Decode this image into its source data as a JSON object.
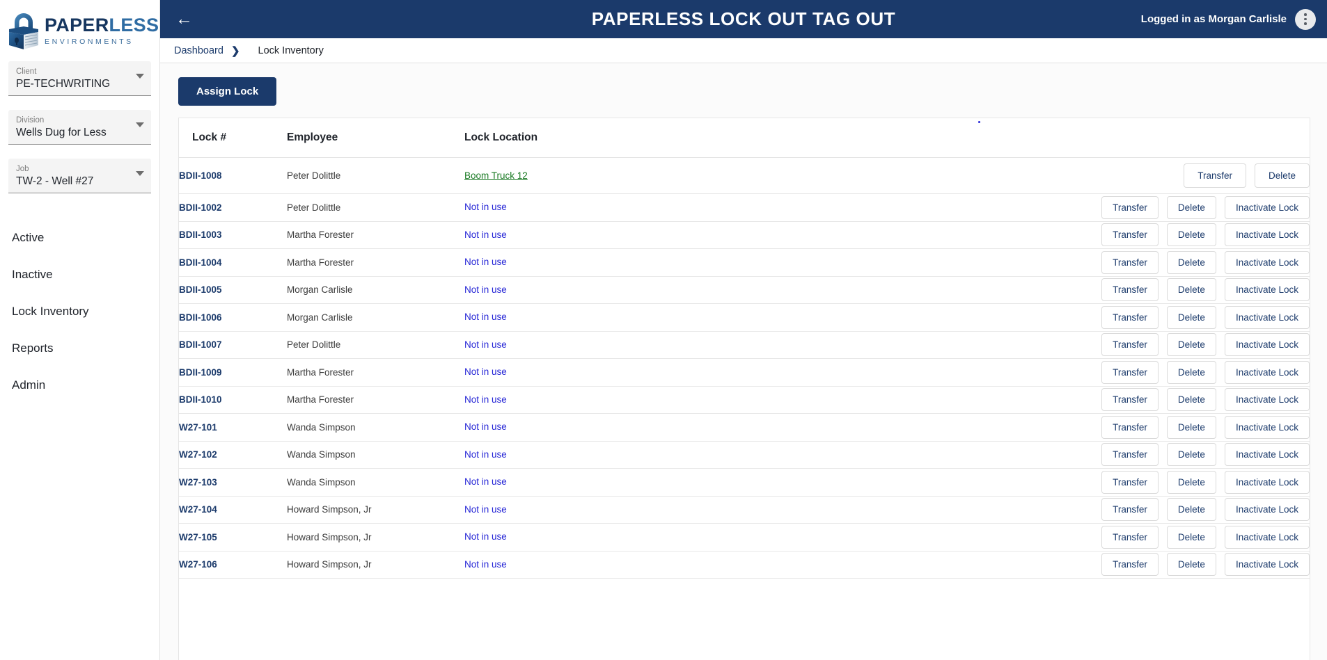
{
  "brand": {
    "title_part1": "PAPER",
    "title_part2": "LESS",
    "subtitle": "ENVIRONMENTS",
    "logo_icon": "padlock-icon",
    "navy": "#1b3a6b",
    "accent_blue": "#2f6ca3"
  },
  "header": {
    "back_icon": "back-arrow-icon",
    "title": "PAPERLESS LOCK OUT TAG OUT",
    "user_status": "Logged in as Morgan Carlisle",
    "menu_icon": "kebab-menu-icon"
  },
  "breadcrumb": {
    "parent": "Dashboard",
    "separator": "›",
    "current": "Lock Inventory"
  },
  "sidebar": {
    "selects": [
      {
        "label": "Client",
        "value": "PE-TECHWRITING",
        "icon": "chevron-down-icon"
      },
      {
        "label": "Division",
        "value": "Wells Dug for Less",
        "icon": "chevron-down-icon"
      },
      {
        "label": "Job",
        "value": "TW-2 - Well #27",
        "icon": "chevron-down-icon"
      }
    ],
    "nav": [
      {
        "label": "Active"
      },
      {
        "label": "Inactive"
      },
      {
        "label": "Lock Inventory"
      },
      {
        "label": "Reports"
      },
      {
        "label": "Admin"
      }
    ]
  },
  "toolbar": {
    "assign_lock_label": "Assign Lock"
  },
  "table": {
    "columns": [
      "Lock #",
      "Employee",
      "Lock Location"
    ],
    "action_labels": {
      "transfer": "Transfer",
      "delete": "Delete",
      "inactivate": "Inactivate Lock"
    },
    "not_in_use_text": "Not in use",
    "rows": [
      {
        "lock": "BDII-1008",
        "employee": "Peter Dolittle",
        "location": "Boom Truck 12",
        "in_use": true,
        "actions": [
          "Transfer",
          "Delete"
        ]
      },
      {
        "lock": "BDII-1002",
        "employee": "Peter Dolittle",
        "location": "Not in use",
        "in_use": false,
        "actions": [
          "Transfer",
          "Delete",
          "Inactivate Lock"
        ]
      },
      {
        "lock": "BDII-1003",
        "employee": "Martha Forester",
        "location": "Not in use",
        "in_use": false,
        "actions": [
          "Transfer",
          "Delete",
          "Inactivate Lock"
        ]
      },
      {
        "lock": "BDII-1004",
        "employee": "Martha Forester",
        "location": "Not in use",
        "in_use": false,
        "actions": [
          "Transfer",
          "Delete",
          "Inactivate Lock"
        ]
      },
      {
        "lock": "BDII-1005",
        "employee": "Morgan Carlisle",
        "location": "Not in use",
        "in_use": false,
        "actions": [
          "Transfer",
          "Delete",
          "Inactivate Lock"
        ]
      },
      {
        "lock": "BDII-1006",
        "employee": "Morgan Carlisle",
        "location": "Not in use",
        "in_use": false,
        "actions": [
          "Transfer",
          "Delete",
          "Inactivate Lock"
        ]
      },
      {
        "lock": "BDII-1007",
        "employee": "Peter Dolittle",
        "location": "Not in use",
        "in_use": false,
        "actions": [
          "Transfer",
          "Delete",
          "Inactivate Lock"
        ]
      },
      {
        "lock": "BDII-1009",
        "employee": "Martha Forester",
        "location": "Not in use",
        "in_use": false,
        "actions": [
          "Transfer",
          "Delete",
          "Inactivate Lock"
        ]
      },
      {
        "lock": "BDII-1010",
        "employee": "Martha Forester",
        "location": "Not in use",
        "in_use": false,
        "actions": [
          "Transfer",
          "Delete",
          "Inactivate Lock"
        ]
      },
      {
        "lock": "W27-101",
        "employee": "Wanda Simpson",
        "location": "Not in use",
        "in_use": false,
        "actions": [
          "Transfer",
          "Delete",
          "Inactivate Lock"
        ]
      },
      {
        "lock": "W27-102",
        "employee": "Wanda Simpson",
        "location": "Not in use",
        "in_use": false,
        "actions": [
          "Transfer",
          "Delete",
          "Inactivate Lock"
        ]
      },
      {
        "lock": "W27-103",
        "employee": "Wanda Simpson",
        "location": "Not in use",
        "in_use": false,
        "actions": [
          "Transfer",
          "Delete",
          "Inactivate Lock"
        ]
      },
      {
        "lock": "W27-104",
        "employee": "Howard Simpson, Jr",
        "location": "Not in use",
        "in_use": false,
        "actions": [
          "Transfer",
          "Delete",
          "Inactivate Lock"
        ]
      },
      {
        "lock": "W27-105",
        "employee": "Howard Simpson, Jr",
        "location": "Not in use",
        "in_use": false,
        "actions": [
          "Transfer",
          "Delete",
          "Inactivate Lock"
        ]
      },
      {
        "lock": "W27-106",
        "employee": "Howard Simpson, Jr",
        "location": "Not in use",
        "in_use": false,
        "actions": [
          "Transfer",
          "Delete",
          "Inactivate Lock"
        ]
      }
    ]
  }
}
